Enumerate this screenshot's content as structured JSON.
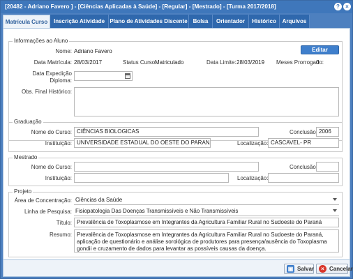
{
  "window": {
    "title": "[20482 - Adriano Favero ] - [Ciências Aplicadas à Saúde] - [Regular] - [Mestrado] - [Turma 2017/2018]"
  },
  "tabs": [
    {
      "label": "Matrícula Curso"
    },
    {
      "label": "Inscrição Atividade"
    },
    {
      "label": "Plano de Atividades Discente"
    },
    {
      "label": "Bolsa"
    },
    {
      "label": "Orientador"
    },
    {
      "label": "Histórico"
    },
    {
      "label": "Arquivos"
    }
  ],
  "aluno": {
    "legend": "Informações ao Aluno",
    "nome_label": "Nome:",
    "nome": "Adriano Favero",
    "edit_label": "Editar",
    "data_matricula_label": "Data Matrícula:",
    "data_matricula": "28/03/2017",
    "status_label": "Status Curso:",
    "status": "Matriculado",
    "data_limite_label": "Data Limite:",
    "data_limite": "28/03/2019",
    "meses_label": "Meses Prorrogado:",
    "meses": "0",
    "data_exp_label_1": "Data Expedição",
    "data_exp_label_2": "Diploma:",
    "data_exp_value": "",
    "obs_label": "Obs. Final Histórico:",
    "obs_value": ""
  },
  "graduacao": {
    "legend": "Graduação",
    "nome_curso_label": "Nome do Curso:",
    "nome_curso": "CIÊNCIAS BIOLOGICAS",
    "conclusao_label": "Conclusão:",
    "conclusao": "2006",
    "instituicao_label": "Instituição:",
    "instituicao": "UNIVERSIDADE ESTADUAL DO OESTE DO PARANA - U",
    "localizacao_label": "Localização:",
    "localizacao": "CASCAVEL- PR"
  },
  "mestrado": {
    "legend": "Mestrado",
    "nome_curso_label": "Nome do Curso:",
    "nome_curso": "",
    "conclusao_label": "Conclusão:",
    "conclusao": "",
    "instituicao_label": "Instituição:",
    "instituicao": "",
    "localizacao_label": "Localização:",
    "localizacao": ""
  },
  "projeto": {
    "legend": "Projeto",
    "area_label": "Área de Concentração:",
    "area": "Ciências da Saúde",
    "linha_label": "Linha de Pesquisa:",
    "linha": "Fisiopatologia Das Doenças Transmissíveis e Não Transmissíveis",
    "titulo_label": "Título:",
    "titulo": "Prevalência de Toxoplasmose em  Integrantes da Agricultura Familiar Rural no  Sudoeste do Paraná",
    "resumo_label": "Resumo:",
    "resumo": "Prevalência de Toxoplasmose em  Integrantes da Agricultura Familiar Rural no  Sudoeste do Paraná, aplicação de questionário e análise sorológica de produtores para presença/ausência do Toxoplasma gondii e cruzamento de dados para levantar as possíveis causas da doença."
  },
  "footer": {
    "save_label": "Salvar",
    "cancel_label": "Cancelar"
  },
  "icons": {
    "help": "help-icon",
    "close": "close-icon",
    "calendar": "calendar-icon",
    "save": "save-icon",
    "cancel": "cancel-icon"
  },
  "colors": {
    "titlebar": "#3f77bb",
    "tab": "#2f68ad",
    "accent": "#3f7fcc",
    "cancel": "#d9362b"
  }
}
